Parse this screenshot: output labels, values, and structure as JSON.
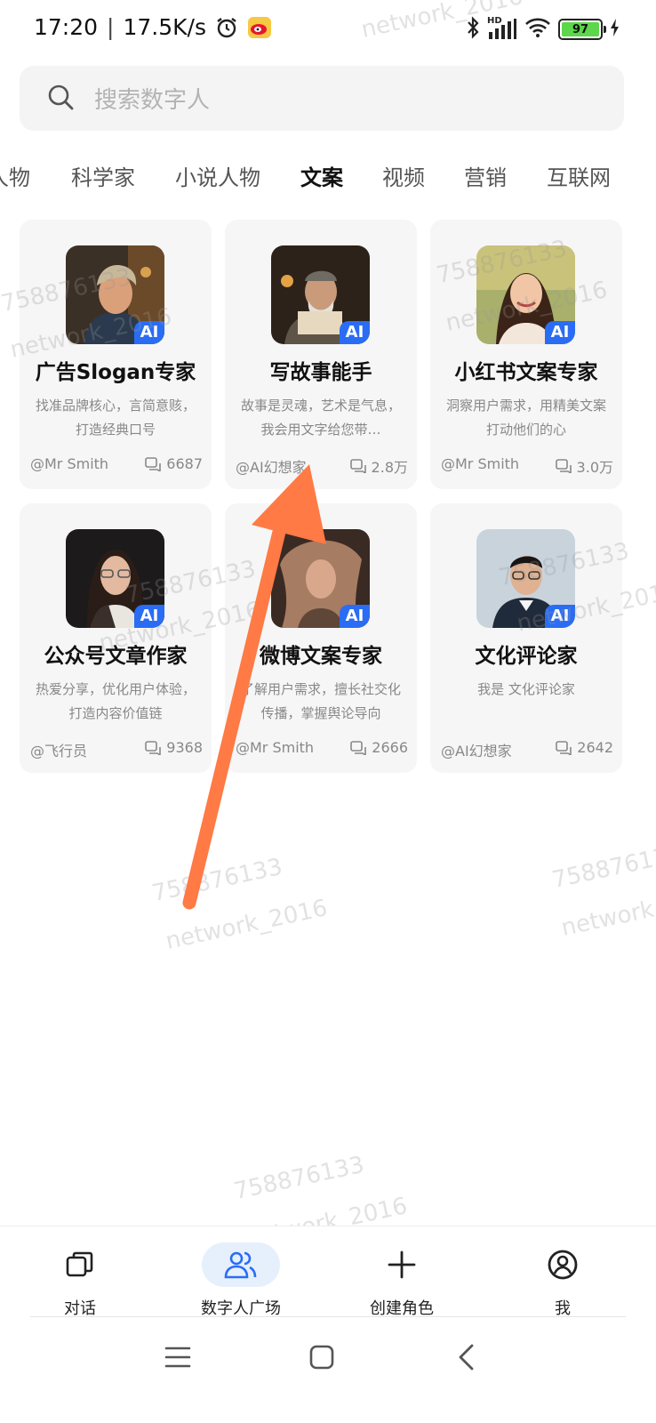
{
  "status_bar": {
    "time": "17:20",
    "separator": "|",
    "network_speed": "17.5K/s",
    "battery_level": "97",
    "icons": [
      "alarm-icon",
      "weibo-icon",
      "bluetooth-icon",
      "signal-icon",
      "wifi-icon",
      "battery-icon",
      "charging-icon"
    ],
    "hd_label": "HD"
  },
  "search": {
    "placeholder": "搜索数字人"
  },
  "tabs": [
    {
      "label": "人物"
    },
    {
      "label": "科学家"
    },
    {
      "label": "小说人物"
    },
    {
      "label": "文案",
      "active": true
    },
    {
      "label": "视频"
    },
    {
      "label": "营销"
    },
    {
      "label": "互联网"
    }
  ],
  "cards": [
    {
      "title": "广告Slogan专家",
      "desc": "找准品牌核心，言简意赅，打造经典口号",
      "author": "@Mr Smith",
      "count": "6687",
      "badge": "AI"
    },
    {
      "title": "写故事能手",
      "desc": "故事是灵魂，艺术是气息，我会用文字给您带…",
      "author": "@AI幻想家",
      "count": "2.8万",
      "badge": "AI"
    },
    {
      "title": "小红书文案专家",
      "desc": "洞察用户需求，用精美文案打动他们的心",
      "author": "@Mr Smith",
      "count": "3.0万",
      "badge": "AI"
    },
    {
      "title": "公众号文章作家",
      "desc": "热爱分享，优化用户体验，打造内容价值链",
      "author": "@飞行员",
      "count": "9368",
      "badge": "AI"
    },
    {
      "title": "微博文案专家",
      "desc": "了解用户需求，擅长社交化传播，掌握舆论导向",
      "author": "@Mr Smith",
      "count": "2666",
      "badge": "AI"
    },
    {
      "title": "文化评论家",
      "desc": "我是 文化评论家",
      "author": "@AI幻想家",
      "count": "2642",
      "badge": "AI"
    }
  ],
  "bottom_nav": [
    {
      "label": "对话",
      "icon": "chat-stack-icon"
    },
    {
      "label": "数字人广场",
      "icon": "people-icon",
      "active": true
    },
    {
      "label": "创建角色",
      "icon": "plus-icon"
    },
    {
      "label": "我",
      "icon": "user-circle-icon"
    }
  ],
  "watermarks": [
    "758876133",
    "network_2016"
  ],
  "colors": {
    "accent": "#2a6df4",
    "arrow": "#ff7a45",
    "active_pill": "#e6f0fd"
  }
}
